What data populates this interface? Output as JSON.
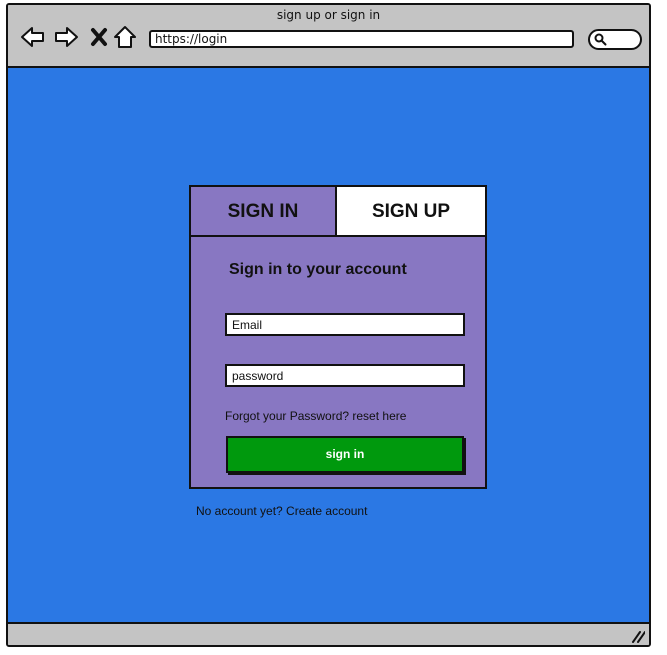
{
  "window": {
    "title": "sign up or sign in"
  },
  "browser": {
    "nav_icons": [
      "back-arrow-icon",
      "forward-arrow-icon",
      "close-x-icon",
      "home-icon"
    ],
    "url": "https://login",
    "search_icon": "search-icon"
  },
  "auth": {
    "tabs": [
      {
        "label": "SIGN IN",
        "active": true
      },
      {
        "label": "SIGN UP",
        "active": false
      }
    ],
    "heading": "Sign in to your account",
    "email_placeholder": "Email",
    "password_placeholder": "password",
    "forgot_text": "Forgot your Password? reset here",
    "submit_label": "sign in",
    "create_account_text": "No account yet? Create account"
  },
  "colors": {
    "page_background": "#2b78e4",
    "card_background": "#8877c2",
    "submit_button": "#00990d",
    "chrome": "#c4c4c4"
  }
}
